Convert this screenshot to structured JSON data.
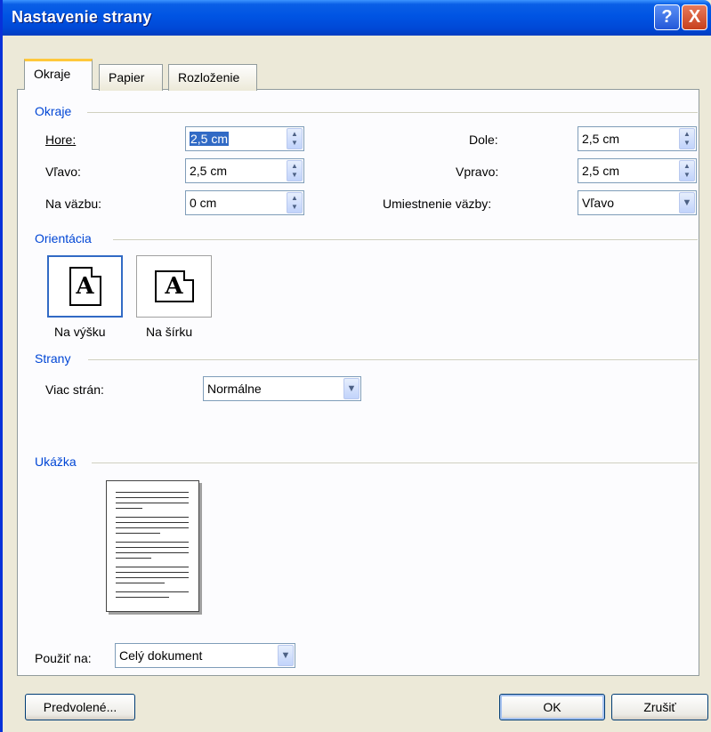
{
  "window": {
    "title": "Nastavenie strany"
  },
  "titlebar_buttons": {
    "help": "?",
    "close": "X"
  },
  "tabs": [
    {
      "label": "Okraje",
      "active": true
    },
    {
      "label": "Papier",
      "active": false
    },
    {
      "label": "Rozloženie",
      "active": false
    }
  ],
  "margins": {
    "section_title": "Okraje",
    "top": {
      "label": "Hore:",
      "value": "2,5 cm"
    },
    "left": {
      "label": "Vľavo:",
      "value": "2,5 cm"
    },
    "gutter": {
      "label": "Na väzbu:",
      "value": "0 cm"
    },
    "bottom": {
      "label": "Dole:",
      "value": "2,5 cm"
    },
    "right": {
      "label": "Vpravo:",
      "value": "2,5 cm"
    },
    "gutter_position": {
      "label": "Umiestnenie väzby:",
      "value": "Vľavo"
    }
  },
  "orientation": {
    "section_title": "Orientácia",
    "portrait": {
      "label": "Na výšku",
      "selected": true
    },
    "landscape": {
      "label": "Na šírku",
      "selected": false
    },
    "glyph": "A"
  },
  "pages": {
    "section_title": "Strany",
    "multiple_pages": {
      "label": "Viac strán:",
      "value": "Normálne"
    }
  },
  "preview": {
    "section_title": "Ukážka"
  },
  "apply_to": {
    "label": "Použiť na:",
    "value": "Celý dokument"
  },
  "buttons": {
    "default": "Predvolené...",
    "ok": "OK",
    "cancel": "Zrušiť"
  },
  "colors": {
    "title_bar": "#0054e3",
    "section_text": "#0046d5",
    "dialog_bg": "#ece9d8",
    "selection": "#316ac5"
  },
  "icons": {
    "spin": "spinner-arrows-icon",
    "combo": "chevron-down-icon",
    "help": "help-icon",
    "close": "close-icon"
  }
}
